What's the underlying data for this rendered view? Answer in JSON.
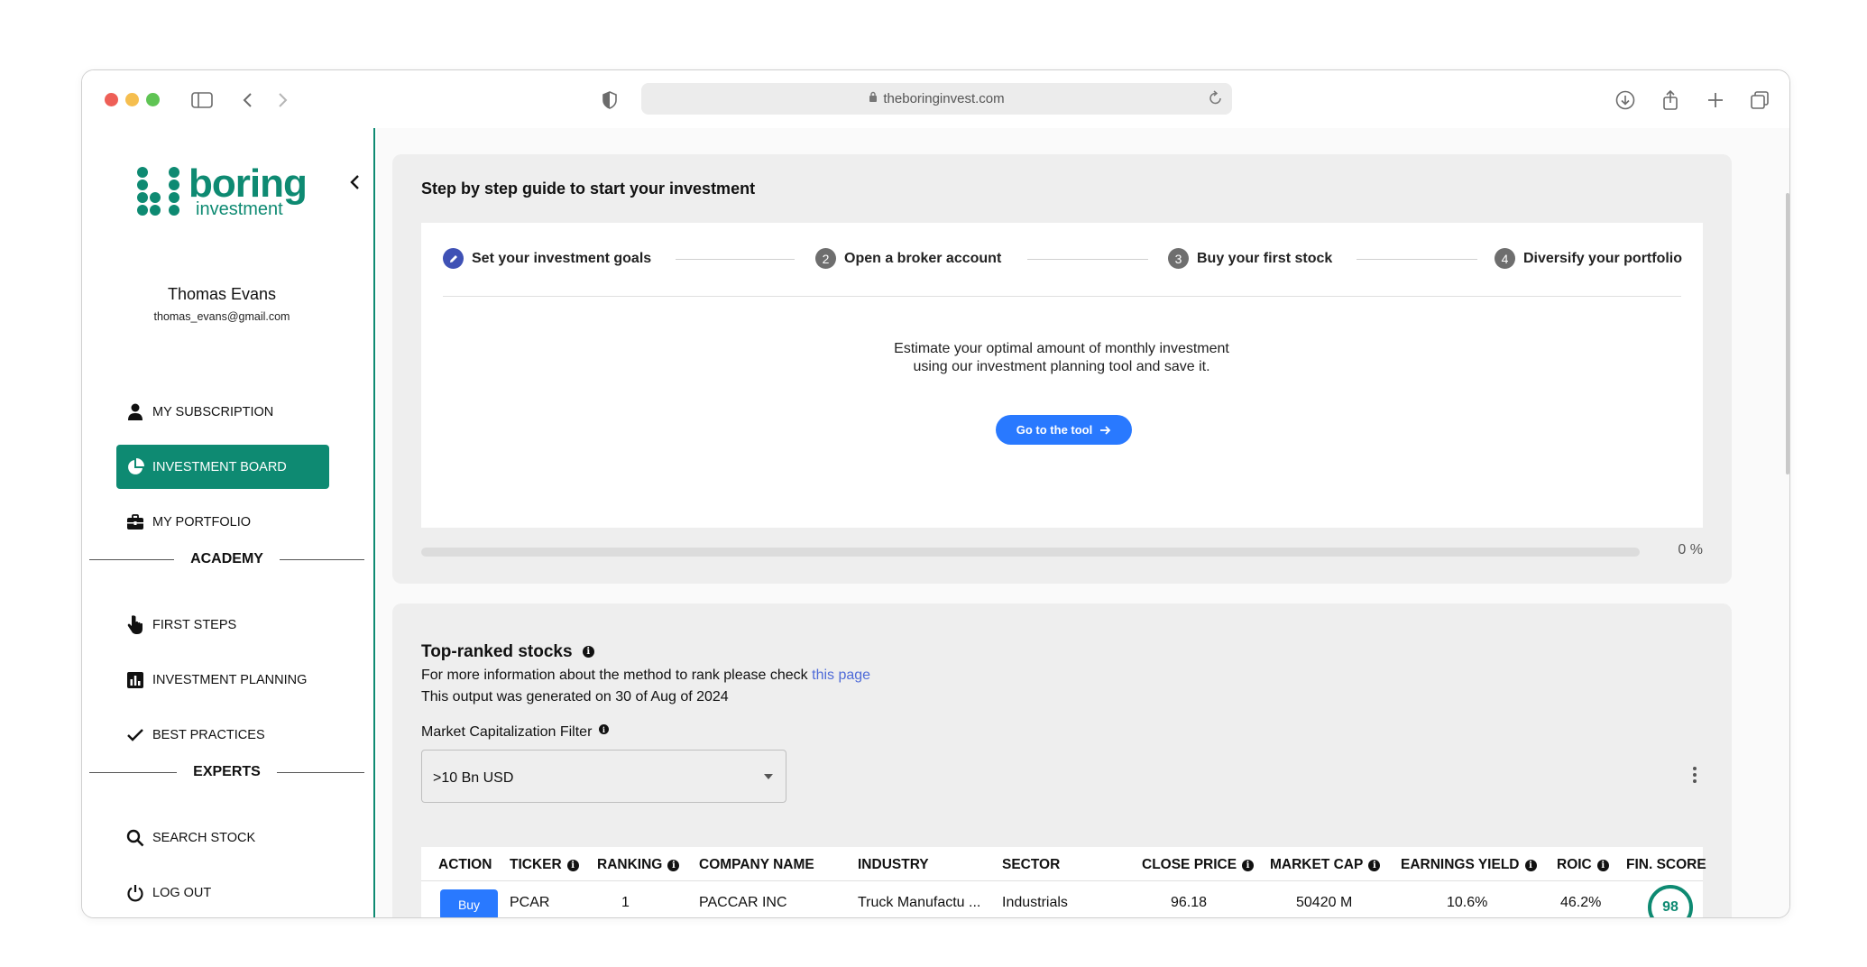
{
  "browser": {
    "url": "theboringinvest.com",
    "traffic_colors": [
      "#ee5f57",
      "#f5be4f",
      "#5fc454"
    ]
  },
  "sidebar": {
    "logo_main": "boring",
    "logo_sub": "investment",
    "user_name": "Thomas Evans",
    "user_email": "thomas_evans@gmail.com",
    "items": [
      {
        "label": "MY SUBSCRIPTION",
        "icon": "person-icon"
      },
      {
        "label": "INVESTMENT BOARD",
        "icon": "pie-chart-icon",
        "active": true
      },
      {
        "label": "MY PORTFOLIO",
        "icon": "briefcase-icon"
      }
    ],
    "academy_label": "ACADEMY",
    "academy_items": [
      {
        "label": "FIRST STEPS",
        "icon": "hand-pointer-icon"
      },
      {
        "label": "INVESTMENT PLANNING",
        "icon": "bar-chart-icon"
      },
      {
        "label": "BEST PRACTICES",
        "icon": "check-icon"
      }
    ],
    "experts_label": "EXPERTS",
    "experts_items": [
      {
        "label": "SEARCH STOCK",
        "icon": "search-icon"
      },
      {
        "label": "LOG OUT",
        "icon": "power-icon"
      }
    ],
    "accent_color": "#0e8a72"
  },
  "guide": {
    "title": "Step by step guide to start your investment",
    "steps": [
      {
        "num": "",
        "label": "Set your investment goals",
        "active": true
      },
      {
        "num": "2",
        "label": "Open a broker account"
      },
      {
        "num": "3",
        "label": "Buy your first stock"
      },
      {
        "num": "4",
        "label": "Diversify your portfolio"
      }
    ],
    "description": "Estimate your optimal amount of monthly investment using our investment planning tool and save it.",
    "button_label": "Go to the tool",
    "progress_value": 0,
    "progress_label": "0 %"
  },
  "ranked": {
    "title": "Top-ranked stocks",
    "info_text": "For more information about the method to rank please check",
    "link_text": "this page",
    "generated_text": "This output was generated on 30 of Aug of 2024",
    "filter_label": "Market Capitalization Filter",
    "filter_value": ">10 Bn USD",
    "columns": [
      "ACTION",
      "TICKER",
      "RANKING",
      "COMPANY NAME",
      "INDUSTRY",
      "SECTOR",
      "CLOSE PRICE",
      "MARKET CAP",
      "EARNINGS YIELD",
      "ROIC",
      "FIN. SCORE"
    ],
    "rows": [
      {
        "action": "Buy",
        "ticker": "PCAR",
        "ranking": "1",
        "company": "PACCAR INC",
        "industry": "Truck Manufactu ...",
        "sector": "Industrials",
        "close_price": "96.18",
        "market_cap": "50420 M",
        "earnings_yield": "10.6%",
        "roic": "46.2%",
        "fin_score": "98"
      }
    ]
  }
}
